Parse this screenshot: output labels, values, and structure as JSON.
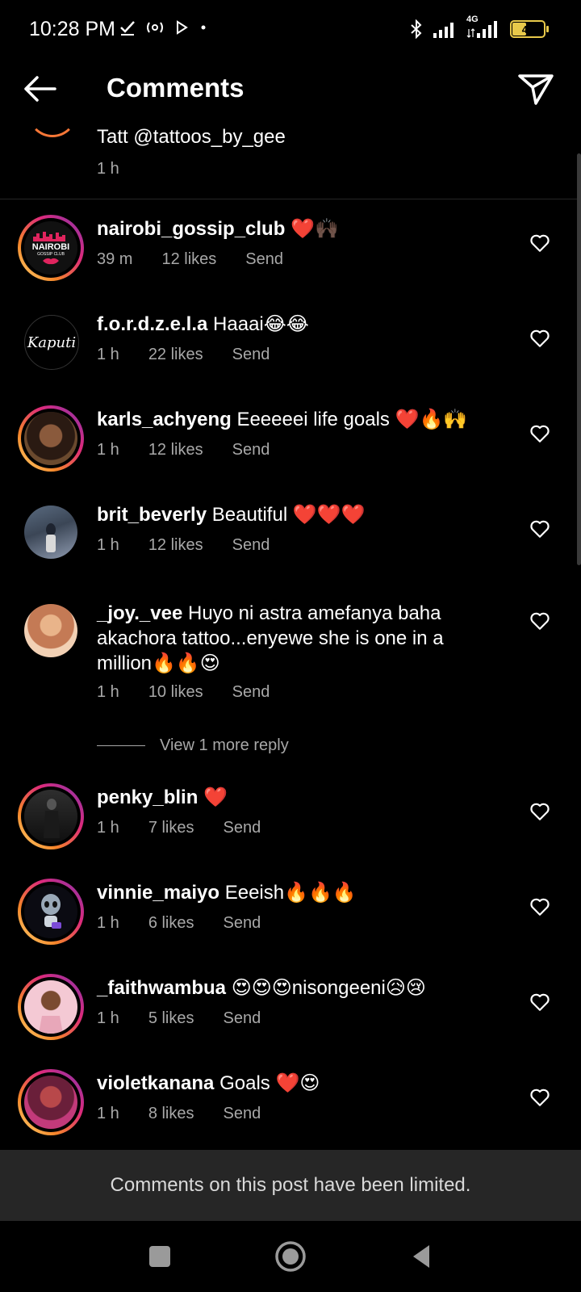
{
  "status": {
    "time": "10:28 PM",
    "network": "4G",
    "battery": "43",
    "battery_fill_percent": 43
  },
  "header": {
    "title": "Comments"
  },
  "partial_comment": {
    "text": "Tatt @tattoos_by_gee",
    "time": "1 h"
  },
  "comments": [
    {
      "username": "nairobi_gossip_club",
      "text": " ❤️🙌🏿",
      "time": "39 m",
      "likes": "12 likes",
      "send": "Send"
    },
    {
      "username": "f.o.r.d.z.e.l.a",
      "text": " Haaai😂😂",
      "time": "1 h",
      "likes": "22 likes",
      "send": "Send"
    },
    {
      "username": "karls_achyeng",
      "text": " Eeeeeei life goals ❤️🔥🙌",
      "time": "1 h",
      "likes": "12 likes",
      "send": "Send"
    },
    {
      "username": "brit_beverly",
      "text": " Beautiful ❤️❤️❤️",
      "time": "1 h",
      "likes": "12 likes",
      "send": "Send"
    },
    {
      "username": "_joy._vee",
      "text": " Huyo ni astra amefanya baha akachora tattoo...enyewe she is one in a million🔥🔥😍",
      "time": "1 h",
      "likes": "10 likes",
      "send": "Send"
    },
    {
      "username": "penky_blin",
      "text": " ❤️",
      "time": "1 h",
      "likes": "7 likes",
      "send": "Send"
    },
    {
      "username": "vinnie_maiyo",
      "text": " Eeeish🔥🔥🔥",
      "time": "1 h",
      "likes": "6 likes",
      "send": "Send"
    },
    {
      "username": "_faithwambua",
      "text": " 😍😍😍nisongeeni😥😢",
      "time": "1 h",
      "likes": "5 likes",
      "send": "Send"
    },
    {
      "username": "violetkanana",
      "text": " Goals ❤️😍",
      "time": "1 h",
      "likes": "8 likes",
      "send": "Send"
    }
  ],
  "avatars": {
    "nairobi_logo_top": "NAIROBI",
    "nairobi_logo_bottom": "GOSSIP CLUB",
    "kaputi_logo": "Kaputi"
  },
  "view_replies": "View 1 more reply",
  "limited_banner": "Comments on this post have been limited.",
  "colors": {
    "background": "#000000",
    "secondary_text": "#a8a8a8",
    "banner_bg": "#262626",
    "story_ring_start": "#feda75",
    "story_ring_end": "#8134af"
  }
}
